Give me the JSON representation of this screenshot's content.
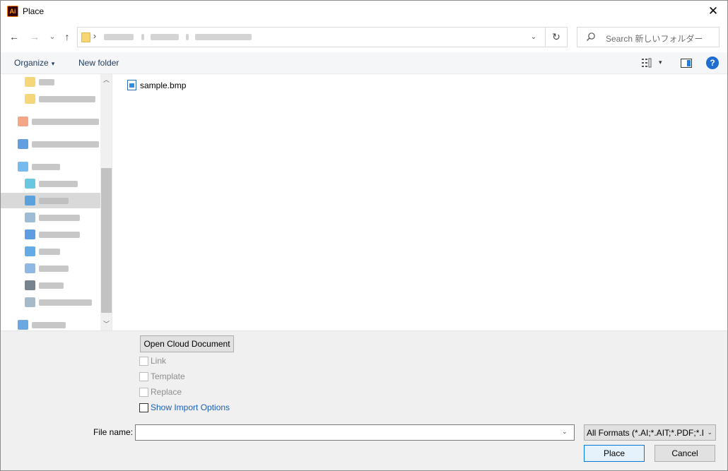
{
  "window": {
    "title": "Place",
    "app_icon_text": "Ai",
    "close_glyph": "✕"
  },
  "nav": {
    "back_glyph": "←",
    "forward_glyph": "→",
    "recent_glyph": "⌄",
    "up_glyph": "↑",
    "address_separator": "›",
    "address_dropdown_glyph": "⌄",
    "refresh_glyph": "↻",
    "search_placeholder": "Search 新しいフォルダー"
  },
  "toolbar": {
    "organize_label": "Organize",
    "caret": "▾",
    "new_folder_label": "New folder",
    "help_glyph": "?"
  },
  "sidebar": {
    "scroll_up_glyph": "︿",
    "scroll_down_glyph": "﹀",
    "items": [
      {
        "icon": "folder-icon",
        "color": "#f2c94c"
      },
      {
        "icon": "folder-icon",
        "color": "#f2c94c"
      },
      {
        "icon": "creative-cloud-files-icon",
        "color": "#f08a5d"
      },
      {
        "icon": "onedrive-icon",
        "color": "#2d7fd3"
      },
      {
        "icon": "this-pc-icon",
        "color": "#4aa3e8"
      },
      {
        "icon": "3d-objects-icon",
        "color": "#3ab3d6"
      },
      {
        "icon": "desktop-icon",
        "color": "#2f8fde",
        "selected": true
      },
      {
        "icon": "documents-icon",
        "color": "#7fa6c9"
      },
      {
        "icon": "downloads-icon",
        "color": "#2b7bd8"
      },
      {
        "icon": "music-icon",
        "color": "#2f8fde"
      },
      {
        "icon": "pictures-icon",
        "color": "#6aa0d8"
      },
      {
        "icon": "videos-icon",
        "color": "#4b5a6b"
      },
      {
        "icon": "local-disk-icon",
        "color": "#8aa3b8"
      },
      {
        "icon": "network-icon",
        "color": "#3a8ad6"
      }
    ]
  },
  "files": [
    {
      "name": "sample.bmp",
      "icon": "bitmap-file-icon"
    }
  ],
  "options": {
    "open_cloud_document_label": "Open Cloud Document",
    "link_label": "Link",
    "template_label": "Template",
    "replace_label": "Replace",
    "show_import_options_label": "Show Import Options"
  },
  "filename": {
    "label": "File name:",
    "value": "",
    "dropdown_glyph": "⌄"
  },
  "format": {
    "selected": "All Formats (*.AI;*.AIT;*.PDF;*.D",
    "caret": "⌄"
  },
  "buttons": {
    "place_label": "Place",
    "cancel_label": "Cancel"
  },
  "colors": {
    "accent": "#0078d7",
    "link_blue": "#1a5fb4",
    "command_text": "#1e395b"
  }
}
